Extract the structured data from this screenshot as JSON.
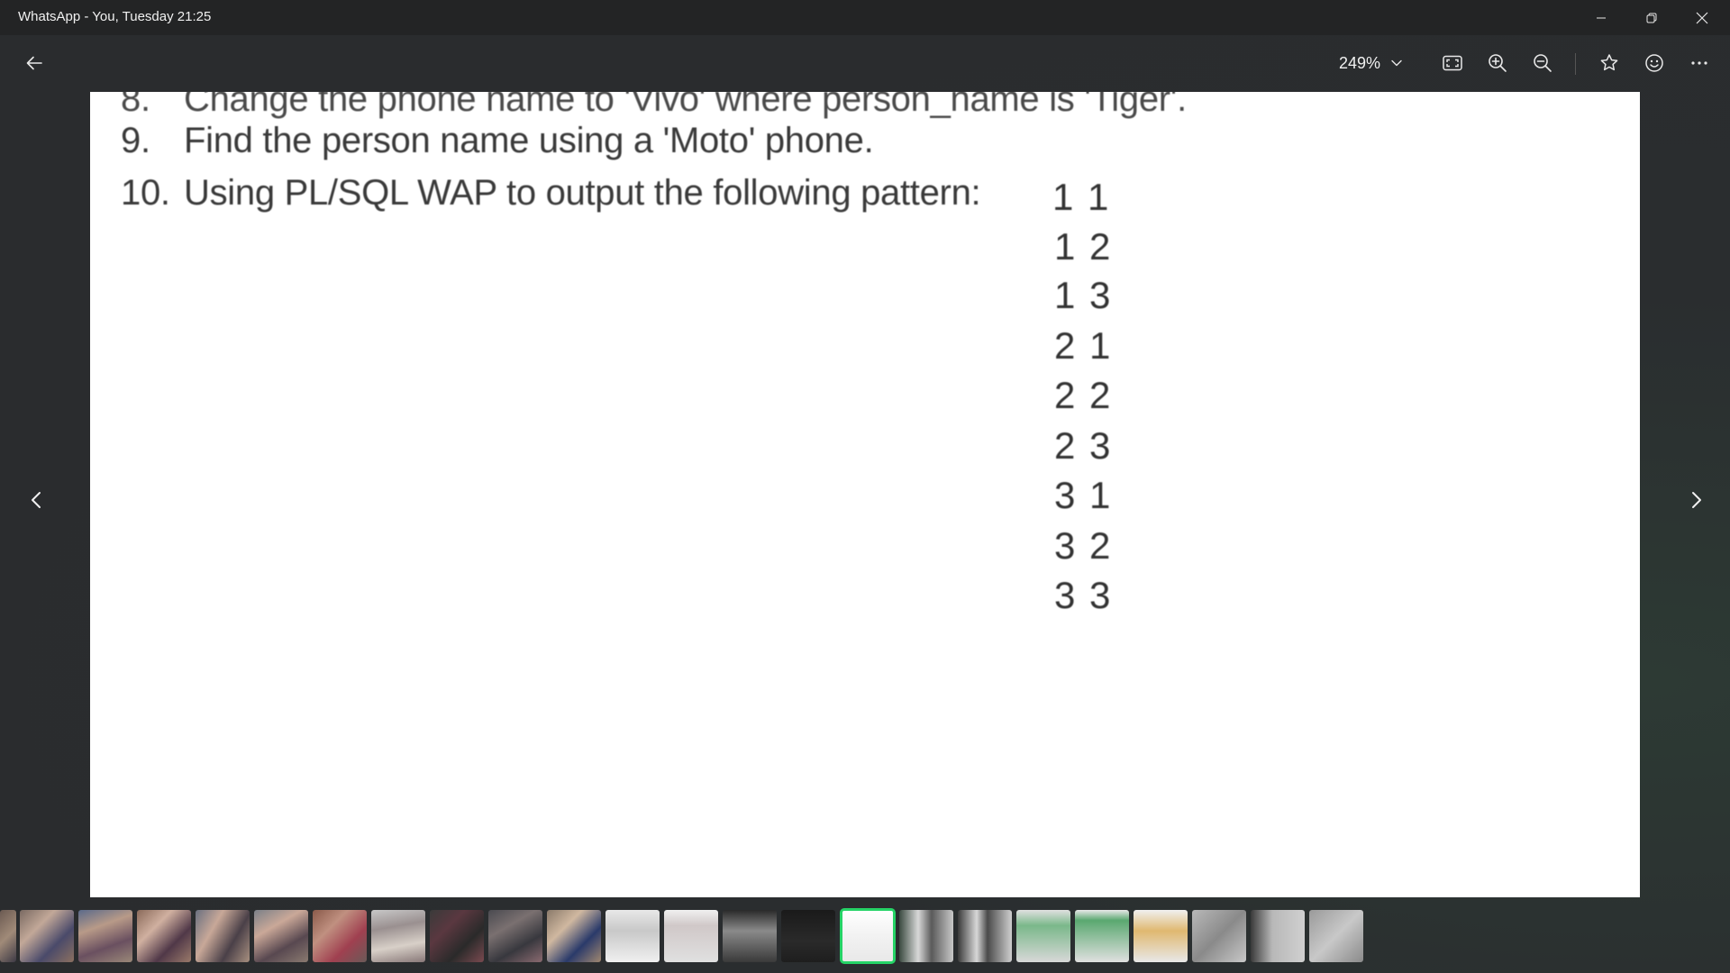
{
  "window": {
    "title": "WhatsApp - You, Tuesday 21:25"
  },
  "toolbar": {
    "zoom_value": "249%"
  },
  "icons": {
    "back": "arrow-left-icon",
    "zoom_dropdown": "chevron-down-icon",
    "fit": "fit-to-window-icon",
    "zoom_in": "zoom-in-icon",
    "zoom_out": "zoom-out-icon",
    "favorite": "star-icon",
    "react": "smiley-icon",
    "more": "more-horizontal-icon",
    "prev": "chevron-left-icon",
    "next": "chevron-right-icon",
    "minimize": "minimize-icon",
    "restore": "restore-icon",
    "close": "close-icon"
  },
  "colors": {
    "accent": "#25d366",
    "titlebar_bg": "#232425",
    "app_bg": "#2a2c2e"
  },
  "document": {
    "lines": [
      {
        "num": "8.",
        "text": "Change the phone name to 'Vivo' where person_name is 'Tiger'."
      },
      {
        "num": "9.",
        "text": "Find the person name using a 'Moto' phone."
      },
      {
        "num": "10.",
        "text": "Using PL/SQL WAP to output the following pattern:"
      }
    ],
    "pattern": [
      "1 1",
      "1 2",
      "1 3",
      "2 1",
      "2 2",
      "2 3",
      "3 1",
      "3 2",
      "3 3"
    ]
  },
  "filmstrip": {
    "selected_index": 14
  }
}
